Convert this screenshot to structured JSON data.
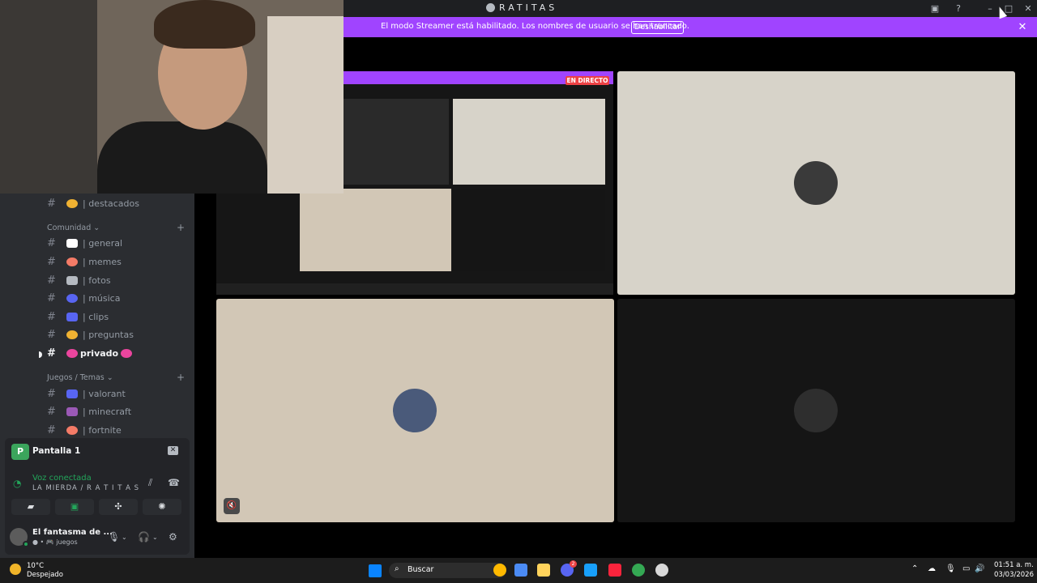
{
  "app": {
    "title": "RATITAS",
    "window_buttons": [
      "minimize",
      "maximize",
      "close"
    ]
  },
  "banner": {
    "text": "El modo Streamer está habilitado. Los nombres de usuario se han truncado.",
    "button_label": "Deshabilitar"
  },
  "sidebar": {
    "top_channel": {
      "label": "| destacados",
      "emoji_color": "#f0b232"
    },
    "categories": [
      {
        "label": "Comunidad ⌄",
        "channels": [
          {
            "label": "| general",
            "emoji_color": "#ffffff"
          },
          {
            "label": "| memes",
            "emoji_color": "#f47b67"
          },
          {
            "label": "| fotos",
            "emoji_color": "#b5bac1"
          },
          {
            "label": "| música",
            "emoji_color": "#5865f2"
          },
          {
            "label": "| clips",
            "emoji_color": "#5865f2"
          },
          {
            "label": "| preguntas",
            "emoji_color": "#f0b232"
          },
          {
            "label": "privado",
            "emoji_color": "#eb459e"
          }
        ]
      },
      {
        "label": "Juegos / Temas ⌄",
        "channels": [
          {
            "label": "| valorant",
            "emoji_color": "#5865f2"
          },
          {
            "label": "| minecraft",
            "emoji_color": "#9b59b6"
          },
          {
            "label": "| fortnite",
            "emoji_color": "#f47b67"
          }
        ]
      }
    ]
  },
  "screenshare": {
    "name": "Pantalla 1",
    "icon_letter": "P"
  },
  "voice": {
    "status": "Voz conectada",
    "channel": "LA MIERDA / R A T I T A S"
  },
  "user": {
    "name": "El fantasma de ...",
    "status": "● • 🎮 juegos"
  },
  "stream": {
    "live_badge": "EN DIRECTO"
  },
  "taskbar": {
    "weather_temp": "10°C",
    "weather_cond": "Despejado",
    "search_placeholder": "Buscar",
    "clock_time": "01:51 a. m.",
    "clock_date": "03/03/2026",
    "app_colors": [
      "#ffb900",
      "#4b8bf5",
      "#ffd35c",
      "#5865f2",
      "#18a0fb",
      "#fa243c",
      "#34a853",
      "#d8d8d8"
    ],
    "discord_badge": "2"
  }
}
